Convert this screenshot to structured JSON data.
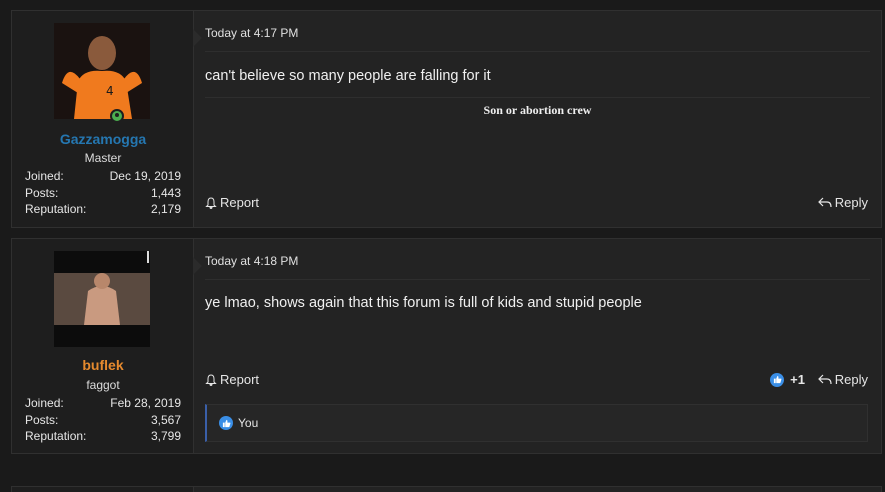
{
  "posts": [
    {
      "user": {
        "name": "Gazzamogga",
        "title": "Master",
        "joined_label": "Joined:",
        "joined": "Dec 19, 2019",
        "posts_label": "Posts:",
        "posts": "1,443",
        "rep_label": "Reputation:",
        "rep": "2,179"
      },
      "time": "Today at 4:17 PM",
      "message": "can't believe so many people are falling for it",
      "signature": "Son or abortion crew",
      "report": "Report",
      "reply": "Reply"
    },
    {
      "user": {
        "name": "buflek",
        "title": "faggot",
        "joined_label": "Joined:",
        "joined": "Feb 28, 2019",
        "posts_label": "Posts:",
        "posts": "3,567",
        "rep_label": "Reputation:",
        "rep": "3,799"
      },
      "time": "Today at 4:18 PM",
      "message": "ye lmao, shows again that this forum is full of kids and stupid people",
      "report": "Report",
      "reply": "Reply",
      "like_count": "+1",
      "reaction_by": "You"
    }
  ],
  "colors": {
    "accent_blue": "#2577b1",
    "accent_orange": "#e68a2e",
    "like_blue": "#3a8ee6"
  }
}
